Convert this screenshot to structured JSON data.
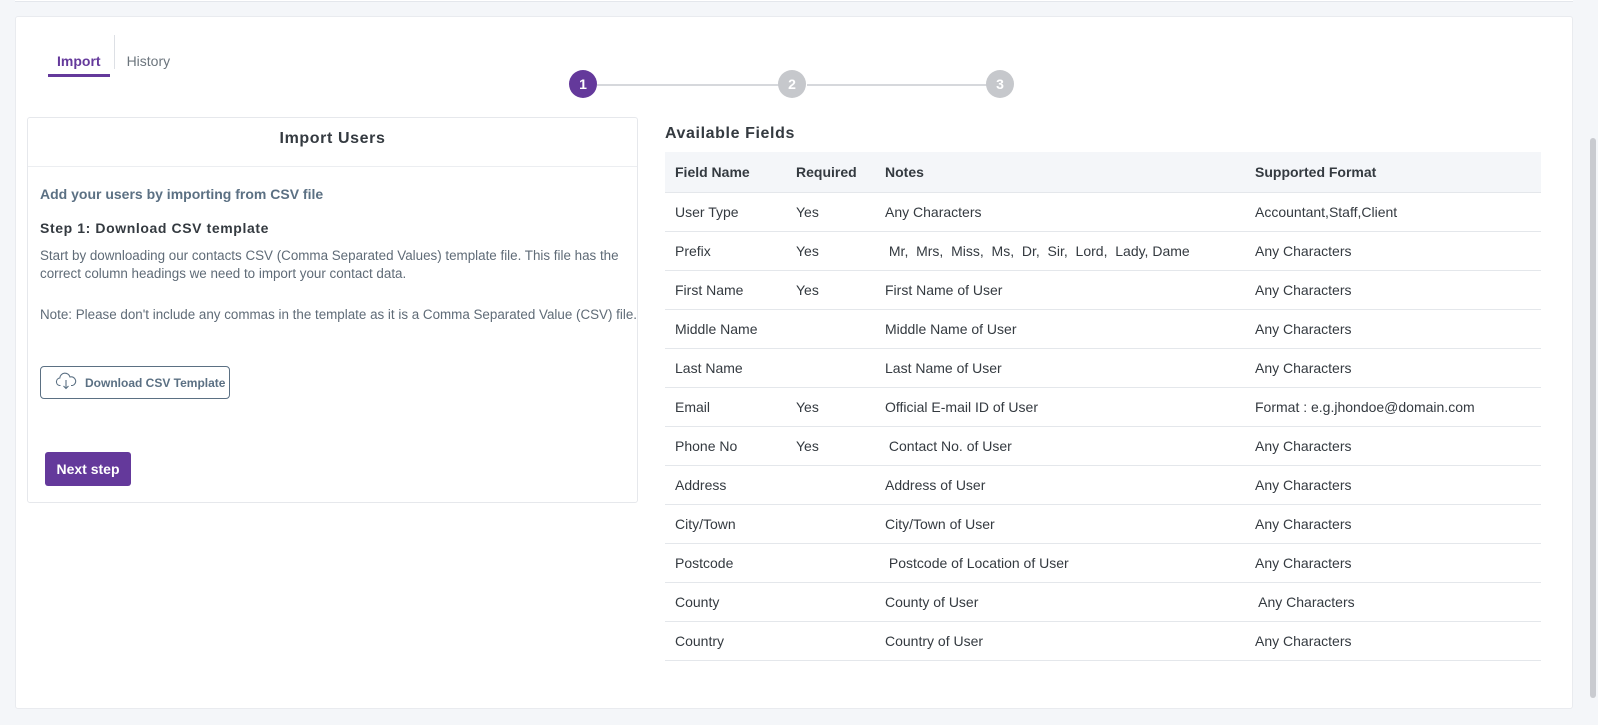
{
  "tabs": [
    {
      "label": "Import",
      "active": true
    },
    {
      "label": "History",
      "active": false
    }
  ],
  "stepper": {
    "steps": [
      {
        "label": "1",
        "active": true
      },
      {
        "label": "2",
        "active": false
      },
      {
        "label": "3",
        "active": false
      }
    ]
  },
  "import_panel": {
    "title": "Import Users",
    "subtitle": "Add your users by importing from CSV file",
    "step_heading": "Step 1: Download CSV template",
    "description": "Start by downloading our contacts CSV (Comma Separated Values) template file. This file has the correct column headings we need to import your contact data.",
    "note": "Note: Please don't include any commas in the template as it is a Comma Separated Value (CSV) file.",
    "download_label": "Download CSV Template",
    "download_icon": "cloud-download-icon",
    "next_label": "Next step"
  },
  "fields": {
    "title": "Available Fields",
    "columns": [
      "Field Name",
      "Required",
      "Notes",
      "Supported Format"
    ],
    "rows": [
      [
        "User Type",
        "Yes",
        "Any Characters",
        "Accountant,Staff,Client"
      ],
      [
        "Prefix",
        "Yes",
        " Mr,  Mrs,  Miss,  Ms,  Dr,  Sir,  Lord,  Lady, Dame",
        "Any Characters"
      ],
      [
        "First Name",
        "Yes",
        "First Name of User",
        "Any Characters"
      ],
      [
        "Middle Name",
        "",
        "Middle Name of User",
        "Any Characters"
      ],
      [
        "Last Name",
        "",
        "Last Name of User",
        "Any Characters"
      ],
      [
        "Email",
        "Yes",
        "Official E-mail ID of User",
        "Format : e.g.jhondoe@domain.com"
      ],
      [
        "Phone No",
        "Yes",
        " Contact No. of User",
        "Any Characters"
      ],
      [
        "Address",
        "",
        "Address of User",
        "Any Characters"
      ],
      [
        "City/Town",
        "",
        "City/Town of User",
        "Any Characters"
      ],
      [
        "Postcode",
        "",
        " Postcode of Location of User",
        "Any Characters"
      ],
      [
        "County",
        "",
        "County of User",
        " Any Characters"
      ],
      [
        "Country",
        "",
        "Country of User",
        "Any Characters"
      ]
    ]
  },
  "colors": {
    "accent": "#64399b",
    "inactive_step": "#c6c8cc",
    "muted": "#5b7083"
  }
}
